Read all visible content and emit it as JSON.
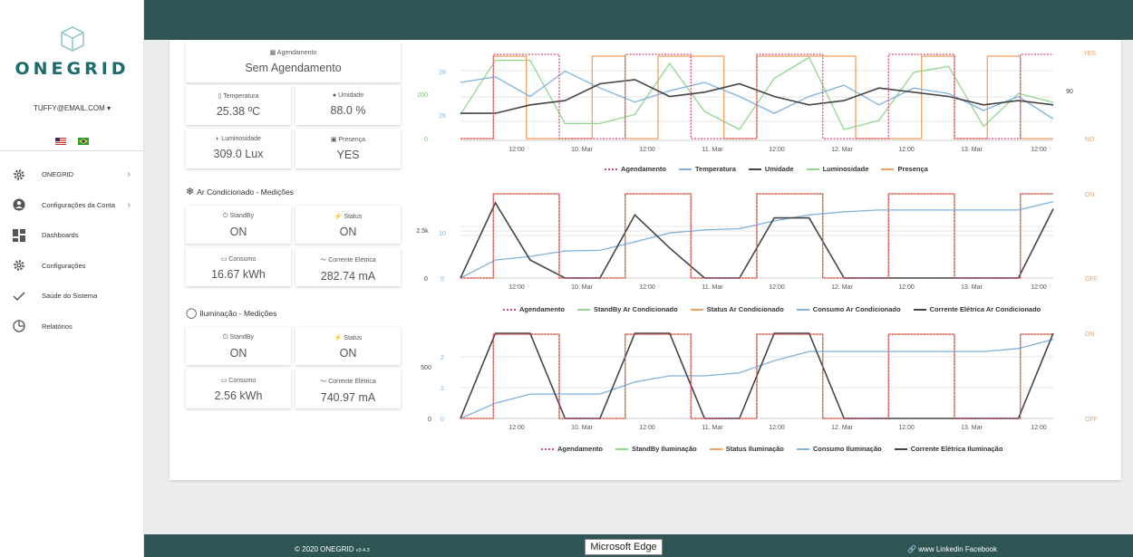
{
  "sidebar": {
    "logo_text": "ONEGRID",
    "user_email": "TUFFY@EMAIL.COM",
    "user_caret": "▾",
    "menu": [
      {
        "label": "ONEGRID",
        "icon": "gear-icon"
      },
      {
        "label": "Configurações da Conta",
        "icon": "account-icon"
      },
      {
        "label": "Dashboards",
        "icon": "dashboard-icon"
      },
      {
        "label": "Configurações",
        "icon": "settings-icon"
      },
      {
        "label": "Saúde do Sistema",
        "icon": "check-icon"
      },
      {
        "label": "Relatórios",
        "icon": "pie-chart-icon"
      }
    ]
  },
  "widgets": {
    "agendamento": {
      "title": "Agendamento",
      "value": "Sem Agendamento"
    },
    "temperatura": {
      "title": "Temperatura",
      "value": "25.38 ºC"
    },
    "umidade": {
      "title": "Umidade",
      "value": "88.0 %"
    },
    "luminosidade": {
      "title": "Luminosidade",
      "value": "309.0 Lux"
    },
    "presenca": {
      "title": "Presença",
      "value": "YES"
    }
  },
  "ar": {
    "section_title": "Ar Condicionado - Medições",
    "standby": {
      "title": "StandBy",
      "value": "ON"
    },
    "status": {
      "title": "Status",
      "value": "ON"
    },
    "consumo": {
      "title": "Consumo",
      "value": "16.67 kWh"
    },
    "corrente": {
      "title": "Corrente Elétrica",
      "value": "282.74 mA"
    }
  },
  "ilum": {
    "section_title": "Iluminação - Medições",
    "standby": {
      "title": "StandBy",
      "value": "ON"
    },
    "status": {
      "title": "Status",
      "value": "ON"
    },
    "consumo": {
      "title": "Consumo",
      "value": "2.56 kWh"
    },
    "corrente": {
      "title": "Corrente Elétrica",
      "value": "740.97 mA"
    }
  },
  "colors": {
    "agendamento": "#d94a7a",
    "temperatura": "#7fb2dc",
    "umidade": "#444444",
    "luminosidade": "#8fd88f",
    "presenca": "#f0a060",
    "brand": "#2e5454"
  },
  "chart_data": [
    {
      "type": "line",
      "x_ticks": [
        "12:00",
        "10. Mar",
        "12:00",
        "11. Mar",
        "12:00",
        "12. Mar",
        "12:00",
        "13. Mar",
        "12:00"
      ],
      "y_axes": {
        "temperatura": {
          "ticks": [
            "28",
            "26"
          ]
        },
        "luminosidade": {
          "ticks": [
            "200",
            "0"
          ]
        },
        "umidade": {
          "ticks": [
            "90"
          ]
        },
        "presenca": {
          "ticks": [
            "YES",
            "NO"
          ]
        }
      },
      "series": [
        {
          "name": "Agendamento",
          "values": [
            0,
            1,
            1,
            0,
            0,
            1,
            1,
            0,
            0,
            1,
            1,
            0,
            0,
            1,
            1,
            0,
            0,
            1
          ]
        },
        {
          "name": "Temperatura",
          "values": [
            27.5,
            27.7,
            27.0,
            27.9,
            27.3,
            26.8,
            27.2,
            27.5,
            27.0,
            26.4,
            27.0,
            27.4,
            26.7,
            27.3,
            27.1,
            26.5,
            27.0,
            26.2
          ]
        },
        {
          "name": "Umidade",
          "values": [
            86,
            86,
            88,
            89,
            93,
            94,
            90,
            91,
            93,
            90,
            88,
            89,
            92,
            91,
            90,
            88,
            89,
            88
          ]
        },
        {
          "name": "Luminosidade",
          "values": [
            80,
            260,
            260,
            50,
            50,
            80,
            250,
            90,
            30,
            200,
            270,
            30,
            60,
            220,
            240,
            40,
            150,
            120
          ]
        },
        {
          "name": "Presença",
          "values": [
            0,
            1,
            0,
            0,
            1,
            0,
            1,
            1,
            0,
            1,
            1,
            1,
            0,
            0,
            1,
            0,
            1,
            0
          ]
        }
      ]
    },
    {
      "type": "line",
      "x_ticks": [
        "12:00",
        "10. Mar",
        "12:00",
        "11. Mar",
        "12:00",
        "12. Mar",
        "12:00",
        "13. Mar",
        "12:00"
      ],
      "y_axes": {
        "consumo": {
          "ticks": [
            "10",
            "0"
          ]
        },
        "corrente": {
          "ticks": [
            "2.5k",
            "0"
          ]
        },
        "status": {
          "ticks": [
            "ON",
            "OFF"
          ]
        }
      },
      "series": [
        {
          "name": "Agendamento",
          "values": [
            0,
            1,
            1,
            0,
            0,
            1,
            1,
            0,
            0,
            1,
            1,
            0,
            0,
            1,
            1,
            0,
            0,
            1
          ]
        },
        {
          "name": "StandBy Ar Condicionado",
          "values": [
            0,
            1,
            1,
            0,
            0,
            1,
            1,
            0,
            0,
            1,
            1,
            0,
            0,
            1,
            1,
            0,
            0,
            1
          ]
        },
        {
          "name": "Status Ar Condicionado",
          "values": [
            0,
            1,
            1,
            0,
            0,
            1,
            1,
            0,
            0,
            1,
            1,
            0,
            0,
            1,
            1,
            0,
            0,
            1
          ]
        },
        {
          "name": "Consumo Ar Condicionado",
          "values": [
            0,
            3,
            3.6,
            4.5,
            4.6,
            6,
            7.5,
            8,
            8.2,
            9.5,
            10.5,
            11,
            11.3,
            11.3,
            11.3,
            11.3,
            11.3,
            12.7
          ]
        },
        {
          "name": "Corrente Elétrica Ar Condicionado",
          "values": [
            0,
            2500,
            600,
            0,
            0,
            2100,
            1000,
            0,
            0,
            2000,
            2000,
            0,
            0,
            0,
            0,
            0,
            0,
            2300
          ]
        }
      ]
    },
    {
      "type": "line",
      "x_ticks": [
        "12:00",
        "10. Mar",
        "12:00",
        "11. Mar",
        "12:00",
        "12. Mar",
        "12:00",
        "13. Mar",
        "12:00"
      ],
      "y_axes": {
        "consumo": {
          "ticks": [
            "2",
            "1",
            "0"
          ]
        },
        "corrente": {
          "ticks": [
            "500",
            "0"
          ]
        },
        "status": {
          "ticks": [
            "ON",
            "OFF"
          ]
        }
      },
      "series": [
        {
          "name": "Agendamento",
          "values": [
            0,
            1,
            1,
            0,
            0,
            1,
            1,
            0,
            0,
            1,
            1,
            0,
            0,
            1,
            1,
            0,
            0,
            1
          ]
        },
        {
          "name": "StandBy Iluminação",
          "values": [
            0,
            1,
            1,
            0,
            0,
            1,
            1,
            0,
            0,
            1,
            1,
            0,
            0,
            1,
            1,
            0,
            0,
            1
          ]
        },
        {
          "name": "Status Iluminação",
          "values": [
            0,
            1,
            1,
            0,
            0,
            1,
            1,
            0,
            0,
            1,
            1,
            0,
            0,
            1,
            1,
            0,
            0,
            1
          ]
        },
        {
          "name": "Consumo Iluminação",
          "values": [
            0,
            0.5,
            0.8,
            0.8,
            0.8,
            1.2,
            1.4,
            1.4,
            1.5,
            1.9,
            2.2,
            2.2,
            2.2,
            2.2,
            2.2,
            2.2,
            2.3,
            2.6
          ]
        },
        {
          "name": "Corrente Elétrica Iluminação",
          "values": [
            0,
            780,
            780,
            0,
            0,
            780,
            780,
            0,
            0,
            780,
            780,
            0,
            0,
            0,
            0,
            0,
            0,
            780
          ]
        }
      ]
    }
  ],
  "footer": {
    "copyright": "© 2020 ONEGRID",
    "version": "v3.4.3",
    "links": "www  Linkedin  Facebook"
  },
  "taskbar": {
    "tooltip": "Microsoft Edge"
  }
}
